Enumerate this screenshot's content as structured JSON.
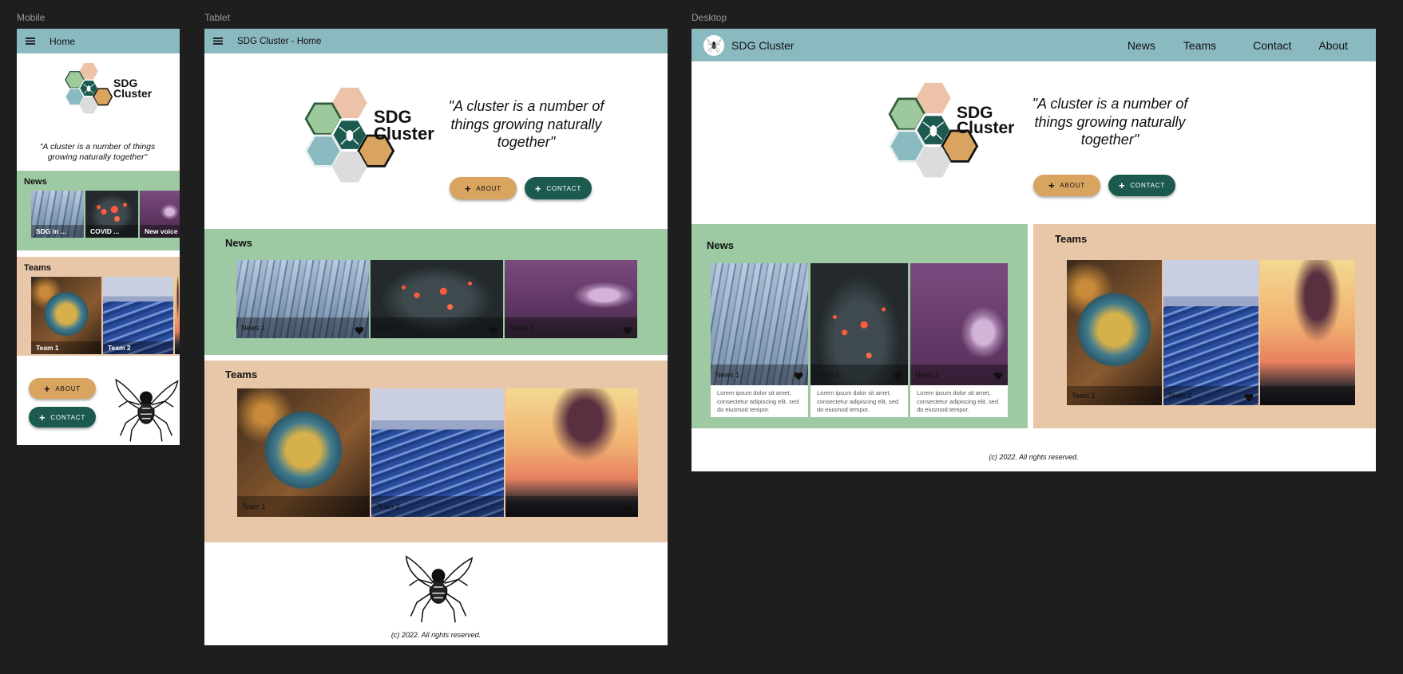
{
  "frames": {
    "mobile_label": "Mobile",
    "tablet_label": "Tablet",
    "desktop_label": "Desktop"
  },
  "brand": {
    "logo_line1": "SDG",
    "logo_line2": "Cluster",
    "quote": "\"A cluster is a number of things growing naturally together\"",
    "colors": {
      "topbar": "#8bb9c0",
      "news_bg": "#9dc9a3",
      "teams_bg": "#e8c6a8",
      "about_button": "#d8a45f",
      "contact_button": "#1c5a50"
    }
  },
  "mobile": {
    "title": "Home",
    "news_title": "News",
    "news_items": [
      "SDG in ...",
      "COVID ...",
      "New voice"
    ],
    "teams_title": "Teams",
    "team_items": [
      "Team 1",
      "Team 2"
    ],
    "about_label": "About",
    "contact_label": "Contact"
  },
  "tablet": {
    "title": "SDG Cluster - Home",
    "news_title": "News",
    "news_items": [
      "News 1",
      "News 2",
      "News 3"
    ],
    "teams_title": "Teams",
    "team_items": [
      "Team 1",
      "Team 2",
      "Team 3"
    ],
    "about_label": "About",
    "contact_label": "Contact",
    "footer": "(c) 2022. All rights reserved."
  },
  "desktop": {
    "brand": "SDG Cluster",
    "nav": [
      "News",
      "Teams",
      "Contact",
      "About"
    ],
    "news_title": "News",
    "news_items": [
      "News 1",
      "News 2",
      "News 3"
    ],
    "news_desc": "Lorem ipsum dolor sit amet, consectetur adipiscing elit, sed do eiusmod tempor.",
    "teams_title": "Teams",
    "team_items": [
      "Team 1",
      "Team 2",
      "Team 3"
    ],
    "about_label": "About",
    "contact_label": "Contact",
    "footer": "(c) 2022. All rights reserved."
  }
}
